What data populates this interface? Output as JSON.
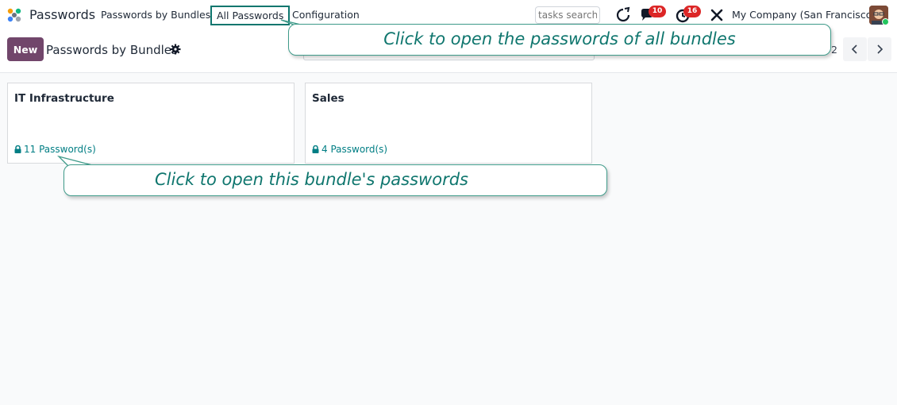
{
  "navbar": {
    "app_name": "Passwords",
    "menu": {
      "bundles": "Passwords by Bundles",
      "all": "All Passwords",
      "config": "Configuration"
    },
    "search_placeholder": "tasks search",
    "badges": {
      "messages": "10",
      "activities": "16"
    },
    "company": "My Company (San Francisco)"
  },
  "control": {
    "new_label": "New",
    "title": "Passwords by Bundles",
    "pager_value": "2"
  },
  "cards": [
    {
      "title": "IT Infrastructure",
      "link": "11 Password(s)"
    },
    {
      "title": "Sales",
      "link": "4 Password(s)"
    }
  ],
  "callouts": {
    "top": "Click to open the passwords of all bundles",
    "bottom": "Click to open this bundle's passwords"
  },
  "colors": {
    "brand": "#71466b",
    "accent": "#017e84",
    "callout_border": "#3f9b8a",
    "badge": "#dc2626"
  },
  "icons": [
    "app-logo-icon",
    "gear-icon",
    "lock-icon",
    "refresh-icon",
    "chat-icon",
    "clock-icon",
    "tools-icon",
    "chevron-left-icon",
    "chevron-right-icon"
  ]
}
